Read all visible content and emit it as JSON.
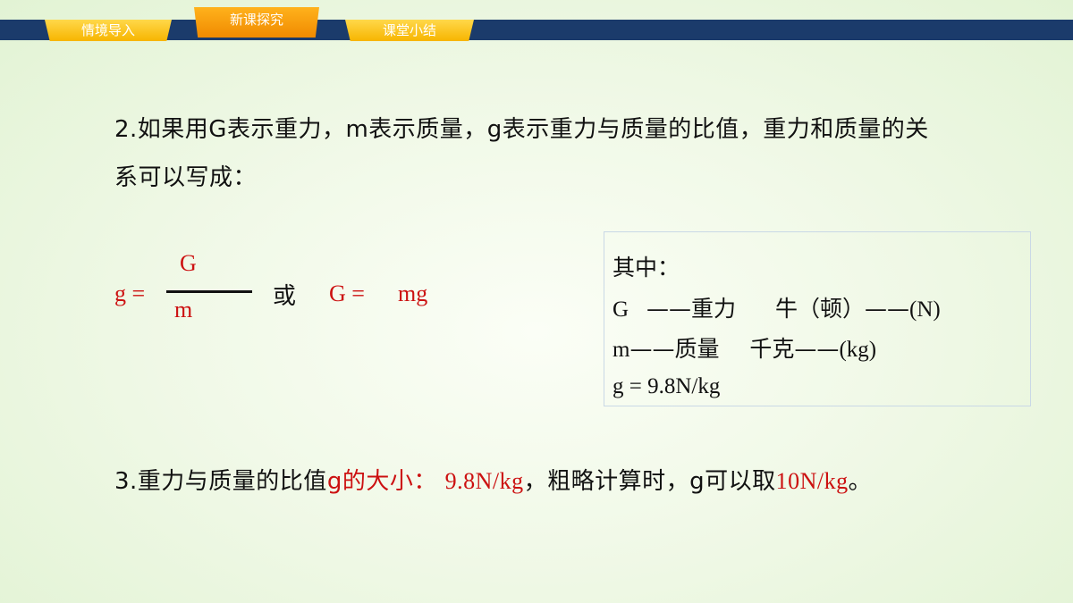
{
  "nav": {
    "tabs": [
      {
        "label": "情境导入"
      },
      {
        "label": "新课探究"
      },
      {
        "label": "课堂小结"
      }
    ]
  },
  "point2": {
    "line1": "2.如果用G表示重力，m表示质量，g表示重力与质量的比值，重力和质量的关",
    "line2": "系可以写成："
  },
  "formula": {
    "g_eq": "g =",
    "numerator": "G",
    "denominator": "m",
    "or": "或",
    "G_eq": "G =",
    "rhs": "mg"
  },
  "legend_box": {
    "title": "其中：",
    "row_G": {
      "symbol": "G",
      "dash": "——",
      "name": "重力",
      "unit_name": "牛（顿）——",
      "unit": "(N)"
    },
    "row_m": {
      "symbol": "m",
      "dash": "——",
      "name": "质量",
      "unit_name": "千克——",
      "unit": "(kg)"
    },
    "row_g": "g = 9.8N/kg"
  },
  "point3": {
    "prefix": "3.重力与质量的比值",
    "highlight1": "g的大小：",
    "value1": "9.8N/kg",
    "middle": "，粗略计算时，g可以取",
    "value2": "10N/kg",
    "suffix": "。"
  }
}
